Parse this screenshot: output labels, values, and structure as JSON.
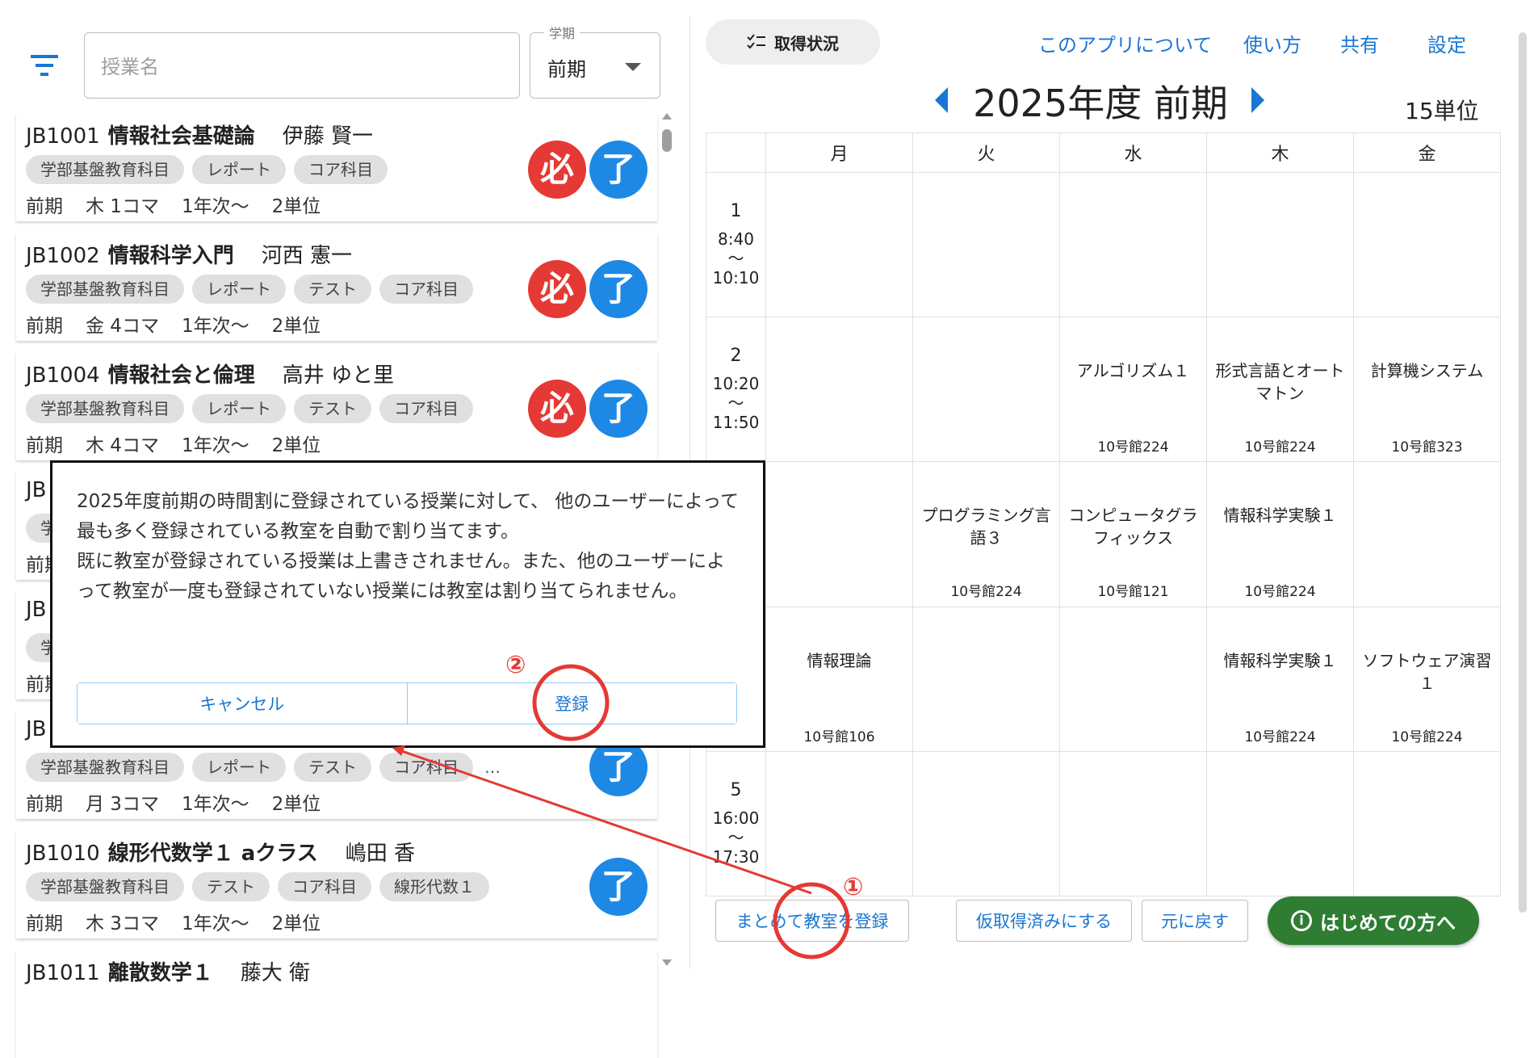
{
  "search": {
    "placeholder": "授業名",
    "value": ""
  },
  "term_select": {
    "label": "学期",
    "value": "前期"
  },
  "courses": [
    {
      "code": "JB1001",
      "name": "情報社会基礎論",
      "teacher": "伊藤 賢一",
      "tags": [
        "学部基盤教育科目",
        "レポート",
        "コア科目"
      ],
      "more": "",
      "term": "前期",
      "slot": "木 1コマ",
      "year": "1年次〜",
      "credits": "2単位",
      "required": "必",
      "done": "了"
    },
    {
      "code": "JB1002",
      "name": "情報科学入門",
      "teacher": "河西 憲一",
      "tags": [
        "学部基盤教育科目",
        "レポート",
        "テスト",
        "コア科目"
      ],
      "more": "",
      "term": "前期",
      "slot": "金 4コマ",
      "year": "1年次〜",
      "credits": "2単位",
      "required": "必",
      "done": "了"
    },
    {
      "code": "JB1004",
      "name": "情報社会と倫理",
      "teacher": "高井 ゆと里",
      "tags": [
        "学部基盤教育科目",
        "レポート",
        "テスト",
        "コア科目"
      ],
      "more": "",
      "term": "前期",
      "slot": "木 4コマ",
      "year": "1年次〜",
      "credits": "2単位",
      "required": "必",
      "done": "了"
    },
    {
      "code": "JB",
      "name": "",
      "teacher": "",
      "tags": [
        "学"
      ],
      "more": "",
      "term": "前期",
      "slot": "",
      "year": "",
      "credits": "",
      "required": "",
      "done": ""
    },
    {
      "code": "JB",
      "name": "",
      "teacher": "",
      "tags": [
        "学"
      ],
      "more": "",
      "term": "前期",
      "slot": "",
      "year": "",
      "credits": "",
      "required": "",
      "done": ""
    },
    {
      "code": "JB",
      "name": "",
      "teacher": "",
      "tags": [
        "学部基盤教育科目",
        "レポート",
        "テスト",
        "コア科目"
      ],
      "more": "…",
      "term": "前期",
      "slot": "月 3コマ",
      "year": "1年次〜",
      "credits": "2単位",
      "required": "",
      "done": "了"
    },
    {
      "code": "JB1010",
      "name": "線形代数学１ aクラス",
      "teacher": "嶋田 香",
      "tags": [
        "学部基盤教育科目",
        "テスト",
        "コア科目",
        "線形代数１"
      ],
      "more": "",
      "term": "前期",
      "slot": "木 3コマ",
      "year": "1年次〜",
      "credits": "2単位",
      "required": "",
      "done": "了"
    },
    {
      "code": "JB1011",
      "name": "離散数学１",
      "teacher": "藤大 衛",
      "tags": [],
      "more": "",
      "term": "",
      "slot": "",
      "year": "",
      "credits": "",
      "required": "",
      "done": ""
    }
  ],
  "header": {
    "status_button": "取得状況",
    "links": [
      "このアプリについて",
      "使い方",
      "共有",
      "設定"
    ]
  },
  "timetable": {
    "title": "2025年度 前期",
    "credits": "15単位",
    "days": [
      "月",
      "火",
      "水",
      "木",
      "金"
    ],
    "periods": [
      {
        "num": "1",
        "start": "8:40",
        "sep": "〜",
        "end": "10:10"
      },
      {
        "num": "2",
        "start": "10:20",
        "sep": "〜",
        "end": "11:50"
      },
      {
        "num": "",
        "start": "",
        "sep": "",
        "end": ""
      },
      {
        "num": "",
        "start": "",
        "sep": "",
        "end": ""
      },
      {
        "num": "5",
        "start": "16:00",
        "sep": "〜",
        "end": "17:30"
      }
    ],
    "cells": [
      [
        {
          "name": "",
          "room": ""
        },
        {
          "name": "",
          "room": ""
        },
        {
          "name": "",
          "room": ""
        },
        {
          "name": "",
          "room": ""
        },
        {
          "name": "",
          "room": ""
        }
      ],
      [
        {
          "name": "",
          "room": ""
        },
        {
          "name": "",
          "room": ""
        },
        {
          "name": "アルゴリズム１",
          "room": "10号館224"
        },
        {
          "name": "形式言語とオートマトン",
          "room": "10号館224"
        },
        {
          "name": "計算機システム",
          "room": "10号館323"
        }
      ],
      [
        {
          "name": "",
          "room": ""
        },
        {
          "name": "プログラミング言語３",
          "room": "10号館224"
        },
        {
          "name": "コンピュータグラフィックス",
          "room": "10号館121"
        },
        {
          "name": "情報科学実験１",
          "room": "10号館224"
        },
        {
          "name": "",
          "room": ""
        }
      ],
      [
        {
          "name": "情報理論",
          "room": "10号館106"
        },
        {
          "name": "",
          "room": ""
        },
        {
          "name": "",
          "room": ""
        },
        {
          "name": "情報科学実験１",
          "room": "10号館224"
        },
        {
          "name": "ソフトウェア演習１",
          "room": "10号館224"
        }
      ],
      [
        {
          "name": "",
          "room": ""
        },
        {
          "name": "",
          "room": ""
        },
        {
          "name": "",
          "room": ""
        },
        {
          "name": "",
          "room": ""
        },
        {
          "name": "",
          "room": ""
        }
      ]
    ]
  },
  "bottom_actions": {
    "bulk_register": "まとめて教室を登録",
    "provisional": "仮取得済みにする",
    "undo": "元に戻す",
    "guide": "はじめての方へ"
  },
  "dialog": {
    "text1": "2025年度前期の時間割に登録されている授業に対して、 他のユーザーによって最も多く登録されている教室を自動で割り当てます。",
    "text2": "既に教室が登録されている授業は上書きされません。また、他のユーザーによって教室が一度も登録されていない授業には教室は割り当てられません。",
    "cancel": "キャンセル",
    "confirm": "登録"
  },
  "annotations": {
    "step1": "①",
    "step2": "②",
    "color": "#e53935"
  }
}
